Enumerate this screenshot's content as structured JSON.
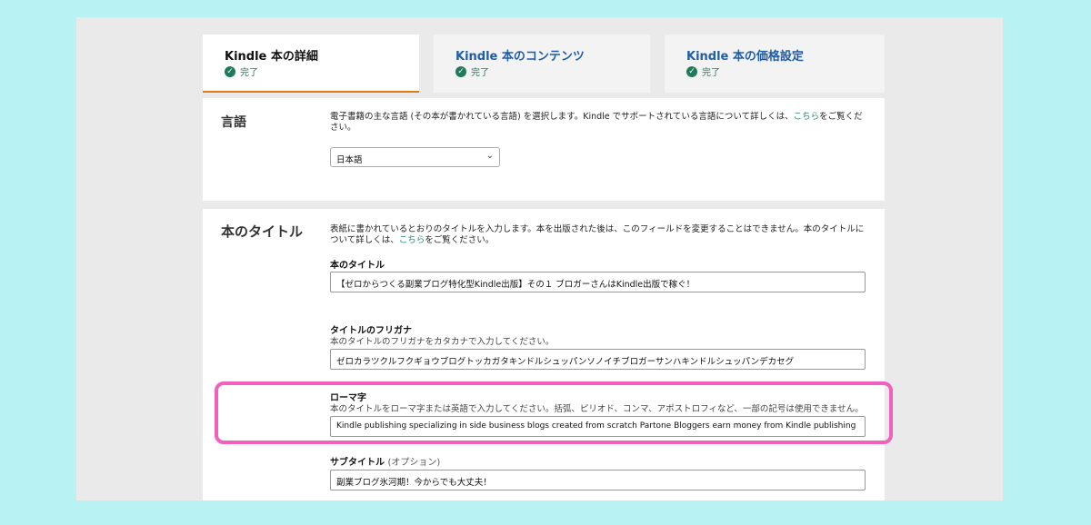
{
  "tabs": [
    {
      "title": "Kindle 本の詳細",
      "status": "完了"
    },
    {
      "title": "Kindle 本のコンテンツ",
      "status": "完了"
    },
    {
      "title": "Kindle 本の価格設定",
      "status": "完了"
    }
  ],
  "language": {
    "label": "言語",
    "desc_prefix": "電子書籍の主な言語 (その本が書かれている言語) を選択します。Kindle でサポートされている言語について詳しくは、",
    "desc_link": "こちら",
    "desc_suffix": "をご覧ください。",
    "selected": "日本語"
  },
  "title_section": {
    "label": "本のタイトル",
    "desc_prefix": "表紙に書かれているとおりのタイトルを入力します。本を出版された後は、このフィールドを変更することはできません。本のタイトルについて詳しくは、",
    "desc_link": "こちら",
    "desc_suffix": "をご覧ください。",
    "book_title": {
      "label": "本のタイトル",
      "value": "【ゼロからつくる副業ブログ特化型Kindle出版】その１ ブロガーさんはKindle出版で稼ぐ！"
    },
    "furigana": {
      "label": "タイトルのフリガナ",
      "help": "本のタイトルのフリガナをカタカナで入力してください。",
      "value": "ゼロカラツクルフクギョウブログトッカガタキンドルシュッパンソノイチブロガーサンハキンドルシュッパンデカセグ"
    },
    "romaji": {
      "label": "ローマ字",
      "help": "本のタイトルをローマ字または英語で入力してください。括弧、ピリオド、コンマ、アポストロフィなど、一部の記号は使用できません。",
      "value": "Kindle publishing specializing in side business blogs created from scratch Partone  Bloggers earn money from Kindle publishing"
    },
    "subtitle": {
      "label": "サブタイトル",
      "optional": "(オプション)",
      "value": "副業ブログ氷河期！今からでも大丈夫！"
    }
  },
  "colors": {
    "background": "#b9f2f3",
    "active_tab_underline": "#e47911",
    "link_blue": "#1f5da8",
    "complete_green": "#1f7a5a",
    "highlight": "#f25fbd"
  }
}
